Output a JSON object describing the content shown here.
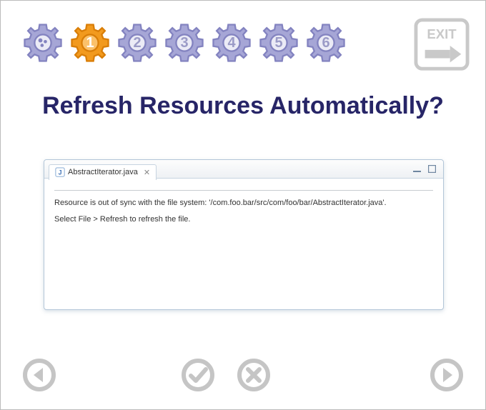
{
  "wizard": {
    "current_step": 1,
    "steps": [
      "1",
      "2",
      "3",
      "4",
      "5",
      "6"
    ],
    "exit_label": "EXIT"
  },
  "heading": "Refresh Resources Automatically?",
  "editor": {
    "tab_filename": "AbstractIterator.java",
    "message_line1": "Resource is out of sync with the file system: '/com.foo.bar/src/com/foo/bar/AbstractIterator.java'.",
    "message_line2": "Select File > Refresh to refresh the file."
  },
  "colors": {
    "gear_inactive_fill": "#a6a6d6",
    "gear_inactive_stroke": "#8383c0",
    "gear_active_fill": "#f29a1e",
    "gear_active_stroke": "#d97e08",
    "heading": "#272567",
    "nav_icon": "#b9b9b9"
  }
}
